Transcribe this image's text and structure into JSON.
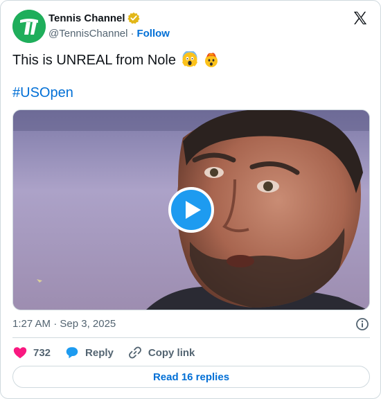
{
  "author": {
    "display_name": "Tennis Channel",
    "handle": "@TennisChannel",
    "separator": "·",
    "follow_label": "Follow"
  },
  "tweet": {
    "text": "This is UNREAL from Nole",
    "emojis": [
      "face-screaming-in-fear",
      "exploding-head"
    ],
    "hashtag": "#USOpen"
  },
  "meta": {
    "timestamp": "1:27 AM · Sep 3, 2025"
  },
  "actions": {
    "like_count": "732",
    "reply_label": "Reply",
    "copy_link_label": "Copy link"
  },
  "read_replies_label": "Read 16 replies",
  "colors": {
    "link": "#006fd6",
    "brand_green": "#1fae5b",
    "play_blue": "#1d9bf0",
    "like_pink": "#f91880",
    "muted": "#536471",
    "border": "#cfd9de"
  }
}
